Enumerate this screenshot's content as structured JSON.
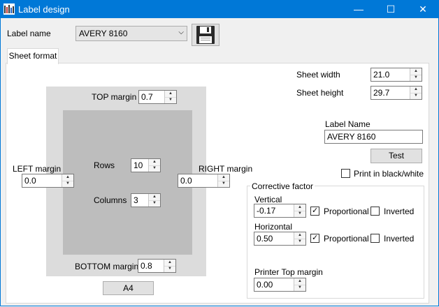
{
  "window": {
    "title": "Label design",
    "minimize": "—",
    "maximize": "☐",
    "close": "✕"
  },
  "label_name": {
    "label": "Label name",
    "value": "AVERY 8160"
  },
  "tabs": [
    {
      "label": "Sheet format"
    }
  ],
  "sheet": {
    "top_margin": {
      "label": "TOP margin",
      "value": "0.7"
    },
    "left_margin": {
      "label": "LEFT margin",
      "value": "0.0"
    },
    "right_margin": {
      "label": "RIGHT margin",
      "value": "0.0"
    },
    "bottom_margin": {
      "label": "BOTTOM margin",
      "value": "0.8"
    },
    "rows": {
      "label": "Rows",
      "value": "10"
    },
    "columns": {
      "label": "Columns",
      "value": "3"
    },
    "format_button": "A4"
  },
  "right": {
    "sheet_width": {
      "label": "Sheet width",
      "value": "21.0"
    },
    "sheet_height": {
      "label": "Sheet height",
      "value": "29.7"
    },
    "label_name": {
      "label": "Label Name",
      "value": "AVERY 8160"
    },
    "test_button": "Test",
    "print_bw": {
      "label": "Print in black/white",
      "checked": false
    }
  },
  "corrective": {
    "title": "Corrective factor",
    "vertical": {
      "label": "Vertical",
      "value": "-0.17",
      "proportional": {
        "label": "Proportional",
        "checked": true
      },
      "inverted": {
        "label": "Inverted",
        "checked": false
      }
    },
    "horizontal": {
      "label": "Horizontal",
      "value": "0.50",
      "proportional": {
        "label": "Proportional",
        "checked": true
      },
      "inverted": {
        "label": "Inverted",
        "checked": false
      }
    },
    "printer_top": {
      "label": "Printer Top margin",
      "value": "0.00"
    }
  },
  "colors": {
    "titlebar": "#0078d7",
    "window_bg": "#f0f0f0",
    "sheet_outer": "#dcdcdc",
    "sheet_inner": "#bdbdbd"
  }
}
